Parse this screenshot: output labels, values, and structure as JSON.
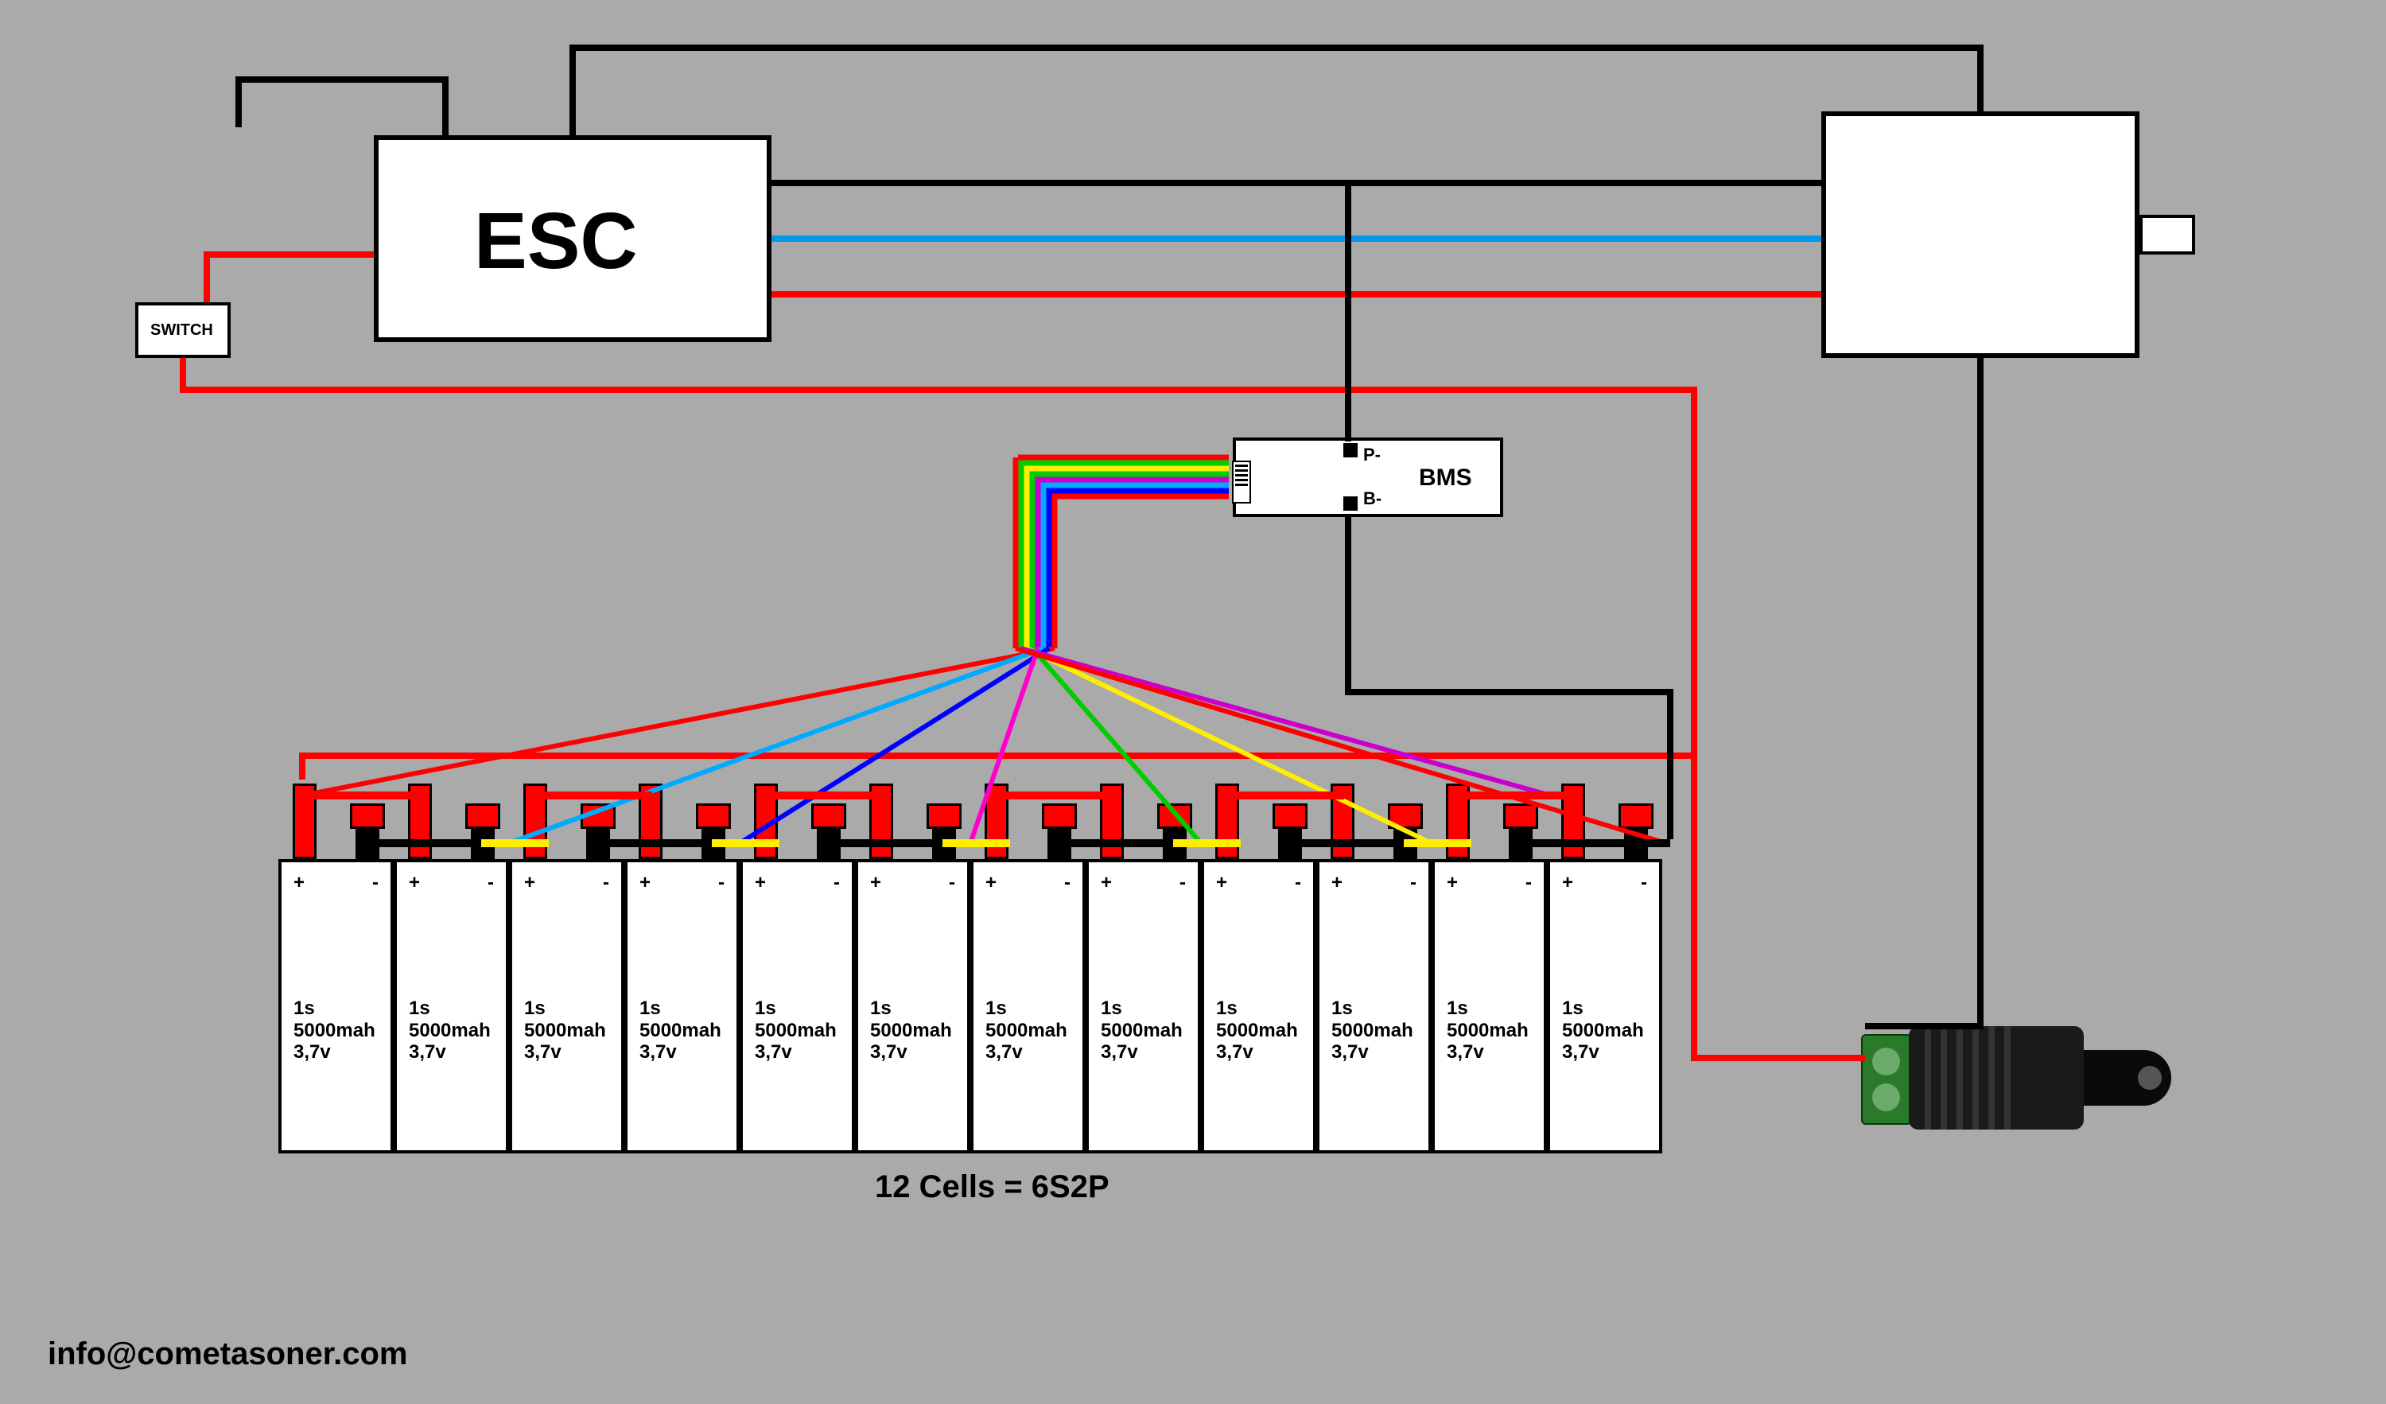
{
  "esc": {
    "label": "ESC"
  },
  "switch": {
    "label": "SWITCH"
  },
  "bms": {
    "label": "BMS",
    "p_minus": "P-",
    "b_minus": "B-"
  },
  "pack_label": "12 Cells = 6S2P",
  "contact": "info@cometasoner.com",
  "cells": [
    {
      "s": "1s",
      "mah": "5000mah",
      "v": "3,7v"
    },
    {
      "s": "1s",
      "mah": "5000mah",
      "v": "3,7v"
    },
    {
      "s": "1s",
      "mah": "5000mah",
      "v": "3,7v"
    },
    {
      "s": "1s",
      "mah": "5000mah",
      "v": "3,7v"
    },
    {
      "s": "1s",
      "mah": "5000mah",
      "v": "3,7v"
    },
    {
      "s": "1s",
      "mah": "5000mah",
      "v": "3,7v"
    },
    {
      "s": "1s",
      "mah": "5000mah",
      "v": "3,7v"
    },
    {
      "s": "1s",
      "mah": "5000mah",
      "v": "3,7v"
    },
    {
      "s": "1s",
      "mah": "5000mah",
      "v": "3,7v"
    },
    {
      "s": "1s",
      "mah": "5000mah",
      "v": "3,7v"
    },
    {
      "s": "1s",
      "mah": "5000mah",
      "v": "3,7v"
    },
    {
      "s": "1s",
      "mah": "5000mah",
      "v": "3,7v"
    }
  ],
  "polarity": {
    "plus": "+",
    "minus": "-"
  },
  "balance_wire_colors": [
    "#ff0000",
    "#00aaff",
    "#0000ff",
    "#ff00cc",
    "#00cc00",
    "#ffee00",
    "#cc00cc",
    "#ff0000"
  ]
}
